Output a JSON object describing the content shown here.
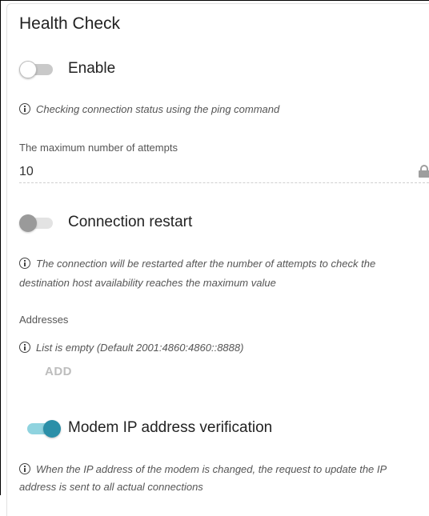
{
  "section": {
    "title": "Health Check"
  },
  "enable": {
    "label": "Enable",
    "state": "off"
  },
  "enable_hint": "Checking connection status using the ping command",
  "max_attempts": {
    "label": "The maximum number of attempts",
    "value": "10"
  },
  "connection_restart": {
    "label": "Connection restart",
    "state": "off-disabled"
  },
  "restart_hint_line1": "The connection will be restarted after the number of attempts to check the",
  "restart_hint_line2": "destination host availability reaches the maximum value",
  "addresses": {
    "label": "Addresses",
    "empty_text": "List is empty (Default 2001:4860:4860::8888)",
    "add_label": "ADD"
  },
  "modem_ip": {
    "label": "Modem IP address verification",
    "state": "on"
  },
  "modem_hint_line1": "When the IP address of the modem is changed, the request to update the IP",
  "modem_hint_line2": "address is sent to all actual connections",
  "colors": {
    "accent": "#2b8fa8",
    "accent_track": "#8fd3df",
    "disabled_button": "#bdbdbd"
  }
}
